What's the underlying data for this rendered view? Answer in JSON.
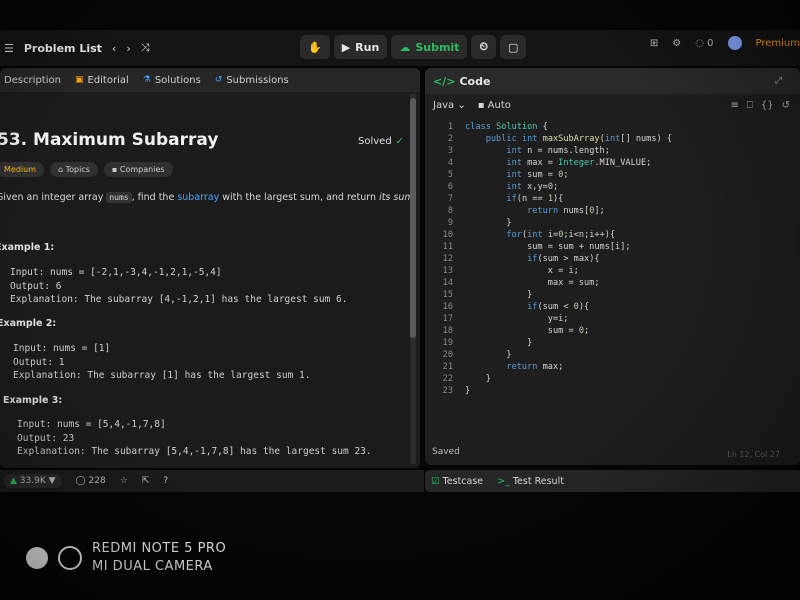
{
  "topbar": {
    "problem_list_label": "Problem List",
    "run_label": "Run",
    "submit_label": "Submit",
    "streak_count": "0",
    "premium_label": "Premium"
  },
  "left_tabs": [
    {
      "label": "Description"
    },
    {
      "label": "Editorial"
    },
    {
      "label": "Solutions"
    },
    {
      "label": "Submissions"
    }
  ],
  "problem": {
    "title": "53. Maximum Subarray",
    "status": "Solved",
    "tags": [
      "Medium",
      "Topics",
      "Companies"
    ],
    "desc_prefix": "Given an integer array ",
    "desc_code": "nums",
    "desc_middle": ", find the ",
    "desc_link": "subarray",
    "desc_suffix_a": " with the largest sum, and return ",
    "desc_em": "its sum",
    "desc_end": "."
  },
  "examples": [
    {
      "title": "Example 1:",
      "input": "Input: nums = [-2,1,-3,4,-1,2,1,-5,4]",
      "output": "Output: 6",
      "explanation": "Explanation: The subarray [4,-1,2,1] has the largest sum 6."
    },
    {
      "title": "Example 2:",
      "input": "Input: nums = [1]",
      "output": "Output: 1",
      "explanation": "Explanation: The subarray [1] has the largest sum 1."
    },
    {
      "title": "Example 3:",
      "input": "Input: nums = [5,4,-1,7,8]",
      "output": "Output: 23",
      "explanation": "Explanation: The subarray [5,4,-1,7,8] has the largest sum 23."
    }
  ],
  "footer": {
    "likes": "33.9K",
    "comments": "228"
  },
  "editor": {
    "panel_title": "Code",
    "language": "Java",
    "mode": "Auto",
    "status": "Saved",
    "cursor": "Ln 12, Col 27",
    "lines": [
      "class Solution {",
      "    public int maxSubArray(int[] nums) {",
      "        int n = nums.length;",
      "        int max = Integer.MIN_VALUE;",
      "        int sum = 0;",
      "        int x,y=0;",
      "        if(n == 1){",
      "            return nums[0];",
      "        }",
      "        for(int i=0;i<n;i++){",
      "            sum = sum + nums[i];",
      "            if(sum > max){",
      "                x = i;",
      "                max = sum;",
      "            }",
      "            if(sum < 0){",
      "                y=i;",
      "                sum = 0;",
      "            }",
      "        }",
      "        return max;",
      "    }",
      "}"
    ]
  },
  "bottom_tabs": [
    "Testcase",
    "Test Result"
  ],
  "watermark": {
    "line1": "REDMI NOTE 5 PRO",
    "line2": "MI DUAL CAMERA"
  }
}
